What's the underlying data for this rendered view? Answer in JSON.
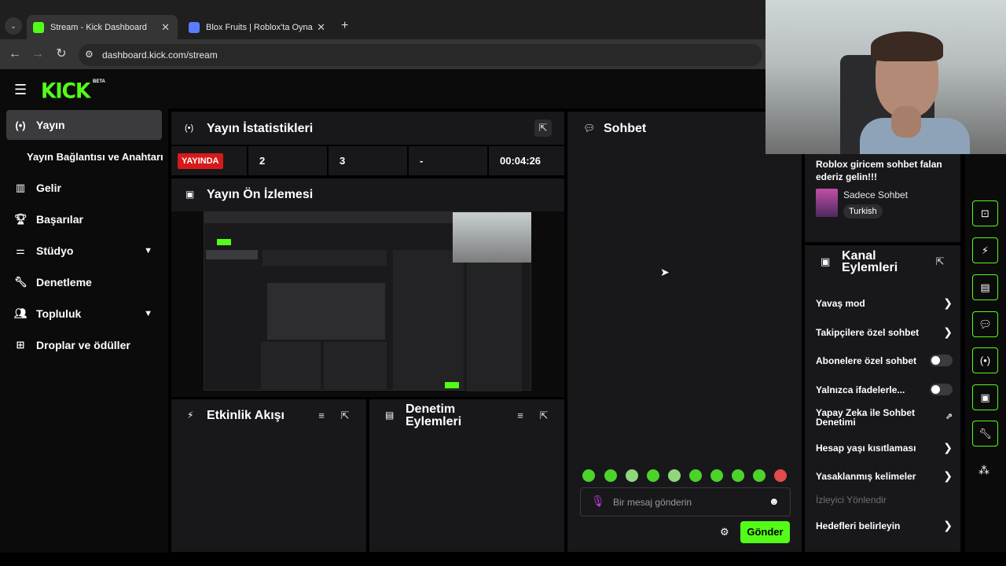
{
  "browser": {
    "tabs": [
      {
        "title": "Stream - Kick Dashboard",
        "active": true
      },
      {
        "title": "Blox Fruits | Roblox'ta Oyna",
        "active": false
      }
    ],
    "url": "dashboard.kick.com/stream"
  },
  "header": {
    "logo": "KICK",
    "beta": "BETA"
  },
  "sidebar": {
    "items": [
      {
        "label": "Yayın",
        "icon": "broadcast-icon",
        "active": true
      },
      {
        "label": "Yayın Bağlantısı ve Anahtarı",
        "icon": "",
        "active": false
      },
      {
        "label": "Gelir",
        "icon": "bar-chart-icon"
      },
      {
        "label": "Başarılar",
        "icon": "trophy-icon"
      },
      {
        "label": "Stüdyo",
        "icon": "sliders-icon",
        "expandable": true
      },
      {
        "label": "Denetleme",
        "icon": "wrench-icon"
      },
      {
        "label": "Topluluk",
        "icon": "users-icon",
        "expandable": true
      },
      {
        "label": "Droplar ve ödüller",
        "icon": "gift-icon"
      }
    ]
  },
  "stats": {
    "title": "Yayın İstatistikleri",
    "live_badge": "YAYINDA",
    "values": [
      "2",
      "3",
      "-",
      "00:04:26"
    ]
  },
  "preview": {
    "title": "Yayın Ön İzlemesi"
  },
  "activity": {
    "title": "Etkinlik Akışı"
  },
  "moderation": {
    "title": "Denetim Eylemleri"
  },
  "chat": {
    "title": "Sohbet",
    "placeholder": "Bir mesaj gönderin",
    "send": "Gönder"
  },
  "stream_info": {
    "stream_title": "Roblox giricem sohbet falan ederiz gelin!!!",
    "category": "Sadece Sohbet",
    "tag": "Turkish"
  },
  "channel_actions": {
    "title": "Kanal Eylemleri",
    "items": [
      {
        "label": "Yavaş mod",
        "control": "chevron"
      },
      {
        "label": "Takipçilere özel sohbet",
        "control": "chevron"
      },
      {
        "label": "Abonelere özel sohbet",
        "control": "toggle",
        "on": false
      },
      {
        "label": "Yalnızca ifadelerle...",
        "control": "toggle",
        "on": false
      },
      {
        "label": "Yapay Zeka ile Sohbet Denetimi",
        "control": "external"
      },
      {
        "label": "Hesap yaşı kısıtlaması",
        "control": "chevron"
      },
      {
        "label": "Yasaklanmış kelimeler",
        "control": "chevron"
      },
      {
        "label": "İzleyici Yönlendir",
        "control": "none",
        "disabled": true
      },
      {
        "label": "Hedefleri belirleyin",
        "control": "chevron"
      }
    ]
  },
  "colors": {
    "accent": "#53fc18",
    "live": "#d61a1a",
    "panel": "#18181b",
    "bg": "#0b0b0c"
  }
}
